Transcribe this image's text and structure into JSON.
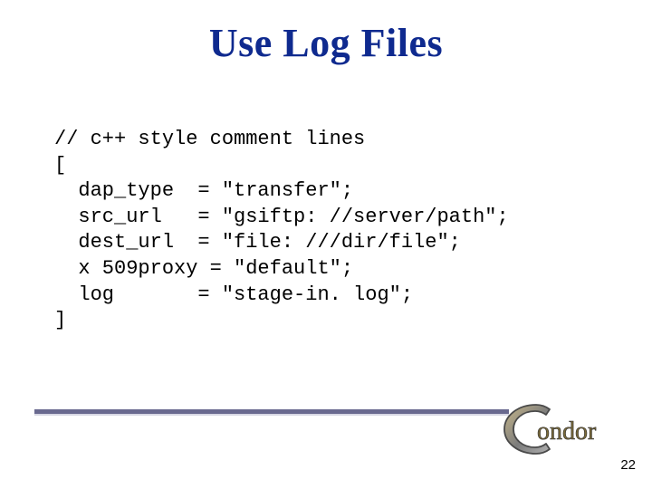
{
  "title": "Use Log Files",
  "code": "// c++ style comment lines\n[\n  dap_type  = \"transfer\";\n  src_url   = \"gsiftp: //server/path\";\n  dest_url  = \"file: ///dir/file\";\n  x 509proxy = \"default\";\n  log       = \"stage-in. log\";\n]",
  "logo_text": "ondor",
  "page": "22"
}
